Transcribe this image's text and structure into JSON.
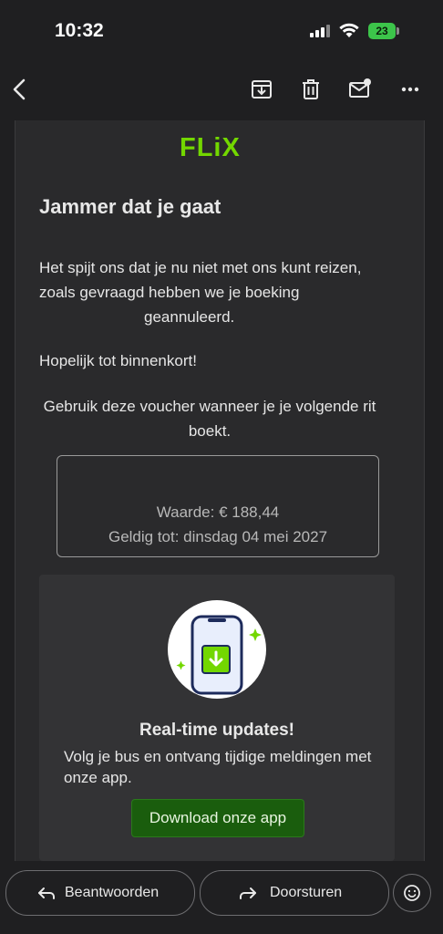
{
  "status_bar": {
    "time": "10:32",
    "battery": "23",
    "icons": [
      "signal-icon",
      "wifi-icon",
      "battery-icon"
    ]
  },
  "toolbar": {
    "back_icon": "chevron-left-icon",
    "actions": [
      "archive-icon",
      "trash-icon",
      "mark-unread-icon",
      "more-icon"
    ]
  },
  "email": {
    "logo": "FLiX",
    "heading": "Jammer dat je gaat",
    "body_line1": "Het spijt ons dat je nu niet met ons kunt reizen,",
    "body_line2": "zoals gevraagd hebben we je boeking",
    "body_line3": "geannuleerd.",
    "closing": "Hopelijk tot binnenkort!",
    "voucher_intro": "Gebruik deze voucher wanneer je je volgende rit boekt.",
    "voucher": {
      "value": "Waarde: € 188,44",
      "valid_until": "Geldig tot: dinsdag 04 mei 2027"
    },
    "promo": {
      "title": "Real-time updates!",
      "text": "Volg je bus en ontvang tijdige meldingen met onze app.",
      "button": "Download onze app"
    }
  },
  "bottom_bar": {
    "reply": "Beantwoorden",
    "forward": "Doorsturen"
  },
  "colors": {
    "brand_green": "#73d700",
    "button_green": "#1a5d0d",
    "background": "#1f1f21",
    "email_bg": "#2a2a2c"
  }
}
